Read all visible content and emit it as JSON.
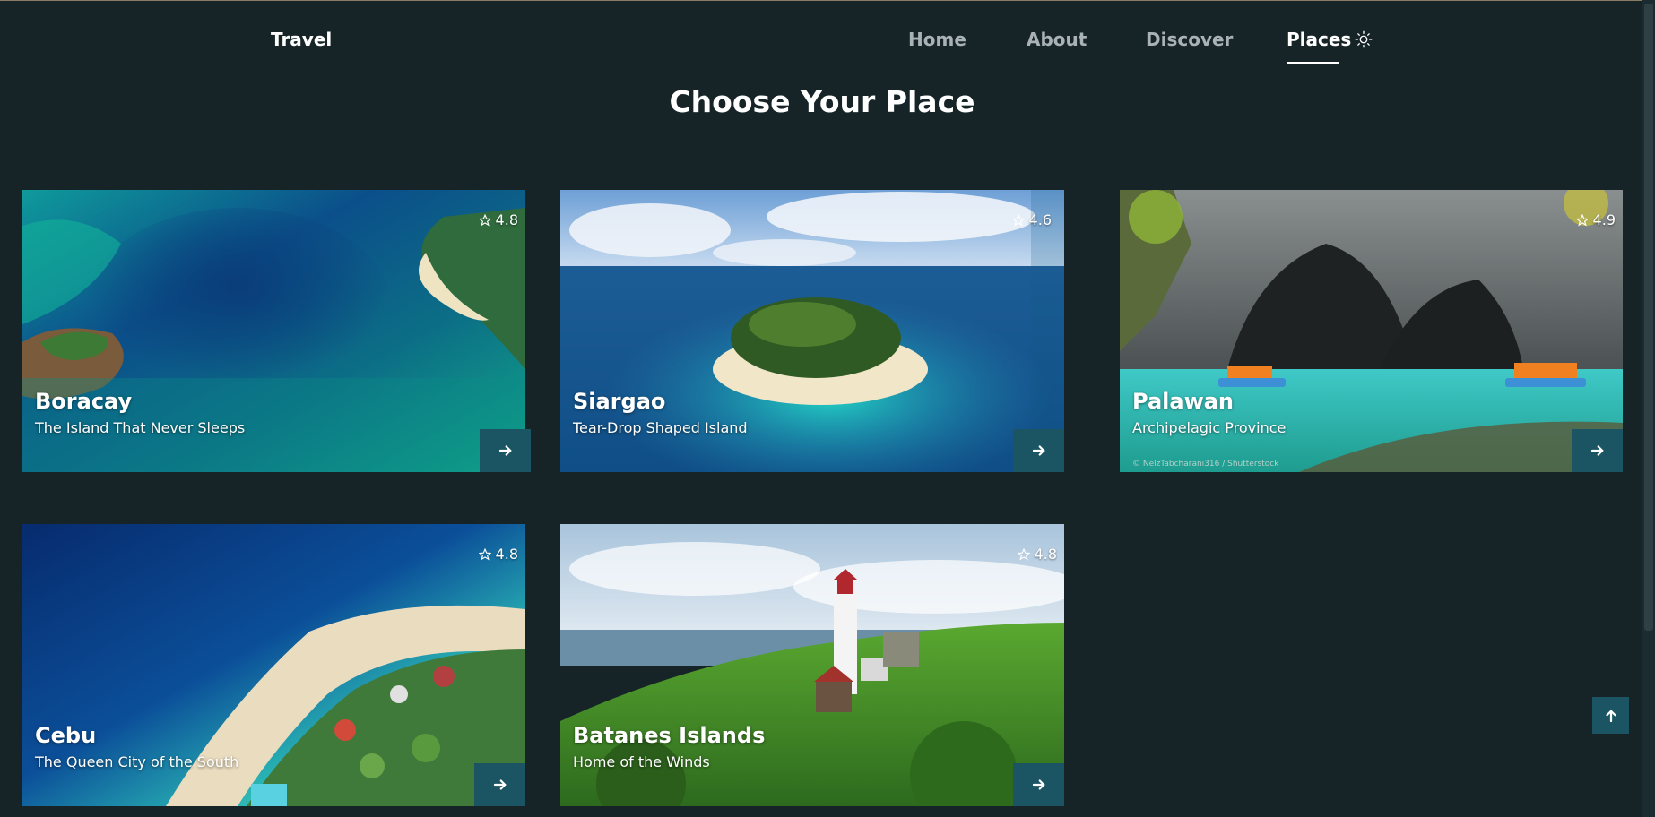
{
  "header": {
    "logo": "Travel",
    "nav": [
      {
        "label": "Home"
      },
      {
        "label": "About"
      },
      {
        "label": "Discover"
      },
      {
        "label": "Places"
      }
    ],
    "active_nav": "Places",
    "theme_icon": "sun-icon"
  },
  "section": {
    "heading": "Choose Your Place"
  },
  "places": [
    {
      "name": "Boracay",
      "tagline": "The Island That Never Sleeps",
      "rating": "4.8"
    },
    {
      "name": "Siargao",
      "tagline": "Tear-Drop Shaped Island",
      "rating": "4.6"
    },
    {
      "name": "Palawan",
      "tagline": "Archipelagic Province",
      "rating": "4.9",
      "credit": "© NelzTabcharani316 / Shutterstock"
    },
    {
      "name": "Cebu",
      "tagline": "The Queen City of the South",
      "rating": "4.8"
    },
    {
      "name": "Batanes Islands",
      "tagline": "Home of the Winds",
      "rating": "4.8"
    }
  ],
  "icons": {
    "rating": "star-icon",
    "card_button": "arrow-right-icon",
    "scroll_top": "arrow-up-icon"
  },
  "colors": {
    "background": "#162428",
    "button": "#1b5563",
    "text": "#ffffff",
    "nav_inactive": "#a9b2b4"
  }
}
